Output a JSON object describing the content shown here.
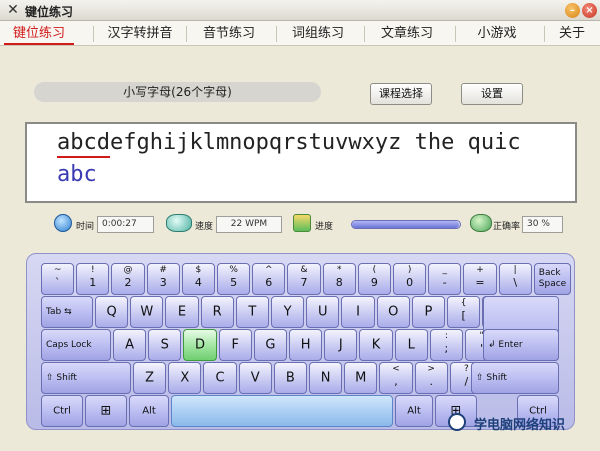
{
  "window": {
    "title": "键位练习",
    "minimize_label": "–",
    "close_label": "×",
    "icon": "x-logo-icon"
  },
  "tabs": [
    {
      "label": "键位练习",
      "active": true
    },
    {
      "label": "汉字转拼音",
      "active": false
    },
    {
      "label": "音节练习",
      "active": false
    },
    {
      "label": "词组练习",
      "active": false
    },
    {
      "label": "文章练习",
      "active": false
    },
    {
      "label": "小游戏",
      "active": false
    },
    {
      "label": "关于",
      "active": false
    }
  ],
  "lesson": {
    "current": "小写字母(26个字母)",
    "course_button": "课程选择",
    "settings_button": "设置"
  },
  "typing": {
    "target_text": "abcdefghijklmnopqrstuvwxyz the quic",
    "typed_text": "abc"
  },
  "status": {
    "time_label": "时间",
    "time_value": "0:00:27",
    "speed_label": "速度",
    "speed_value": "22 WPM",
    "progress_label": "进度",
    "progress_fraction": 0.99,
    "accuracy_label": "正确率",
    "accuracy_value": "30 %"
  },
  "keyboard": {
    "row1": [
      {
        "top": "~",
        "bot": "`"
      },
      {
        "top": "!",
        "bot": "1"
      },
      {
        "top": "@",
        "bot": "2"
      },
      {
        "top": "#",
        "bot": "3"
      },
      {
        "top": "$",
        "bot": "4"
      },
      {
        "top": "%",
        "bot": "5"
      },
      {
        "top": "^",
        "bot": "6"
      },
      {
        "top": "&",
        "bot": "7"
      },
      {
        "top": "*",
        "bot": "8"
      },
      {
        "top": "(",
        "bot": "9"
      },
      {
        "top": ")",
        "bot": "0"
      },
      {
        "top": "_",
        "bot": "-"
      },
      {
        "top": "+",
        "bot": "="
      },
      {
        "top": "|",
        "bot": "\\"
      }
    ],
    "backspace": "Back Space",
    "tab": "Tab",
    "row2": [
      "Q",
      "W",
      "E",
      "R",
      "T",
      "Y",
      "U",
      "I",
      "O",
      "P"
    ],
    "row2_sym": [
      {
        "top": "{",
        "bot": "["
      },
      {
        "top": "}",
        "bot": "]"
      }
    ],
    "caps": "Caps Lock",
    "row3": [
      "A",
      "S",
      "D",
      "F",
      "G",
      "H",
      "J",
      "K",
      "L"
    ],
    "row3_sym": [
      {
        "top": ":",
        "bot": ";"
      },
      {
        "top": "\"",
        "bot": "'"
      }
    ],
    "enter": "Enter",
    "shift_left": "Shift",
    "row4": [
      "Z",
      "X",
      "C",
      "V",
      "B",
      "N",
      "M"
    ],
    "row4_sym": [
      {
        "top": "<",
        "bot": ","
      },
      {
        "top": ">",
        "bot": "."
      },
      {
        "top": "?",
        "bot": "/"
      }
    ],
    "shift_right": "Shift",
    "ctrl": "Ctrl",
    "alt": "Alt",
    "highlight_key": "D"
  },
  "watermark": {
    "text": "学电脑网络知识"
  },
  "colors": {
    "active_tab": "#d11a1a",
    "typed_text": "#3a3bb3",
    "key_highlight": "#6fcf6f"
  }
}
